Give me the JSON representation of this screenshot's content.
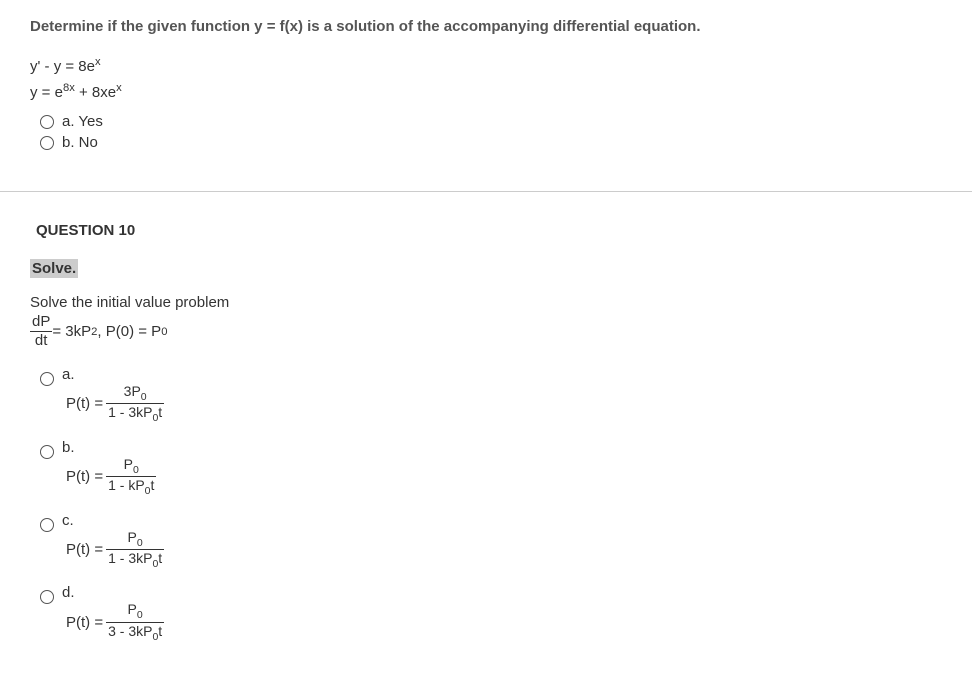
{
  "q9": {
    "prompt": "Determine if the given function y = f(x) is a solution of the accompanying differential equation.",
    "eq1_part1": "y' - y = 8e",
    "eq1_sup": "x",
    "eq2_part1": "y = e",
    "eq2_sup1": "8x",
    "eq2_part2": " + 8xe",
    "eq2_sup2": "x",
    "opt_a": "a. Yes",
    "opt_b": "b. No"
  },
  "q10": {
    "heading": "QUESTION 10",
    "solve_label": "Solve.",
    "problem_text": "Solve the initial value problem",
    "frac_num": "dP",
    "frac_den": "dt",
    "rhs_part1": " = 3kP",
    "rhs_sup": "2",
    "rhs_part2": ", P(0) = P",
    "rhs_sub": "0",
    "options": {
      "a": {
        "letter": "a.",
        "lhs": "P(t) = ",
        "num_p1": "3P",
        "num_sub": "0",
        "den_p1": "1 - 3kP",
        "den_sub": "0",
        "den_p2": "t"
      },
      "b": {
        "letter": "b.",
        "lhs": "P(t) = ",
        "num_p1": "P",
        "num_sub": "0",
        "den_p1": "1 - kP",
        "den_sub": "0",
        "den_p2": "t"
      },
      "c": {
        "letter": "c.",
        "lhs": "P(t) = ",
        "num_p1": "P",
        "num_sub": "0",
        "den_p1": "1 - 3kP",
        "den_sub": "0",
        "den_p2": "t"
      },
      "d": {
        "letter": "d.",
        "lhs": "P(t) = ",
        "num_p1": "P",
        "num_sub": "0",
        "den_p1": "3 - 3kP",
        "den_sub": "0",
        "den_p2": "t"
      }
    }
  }
}
